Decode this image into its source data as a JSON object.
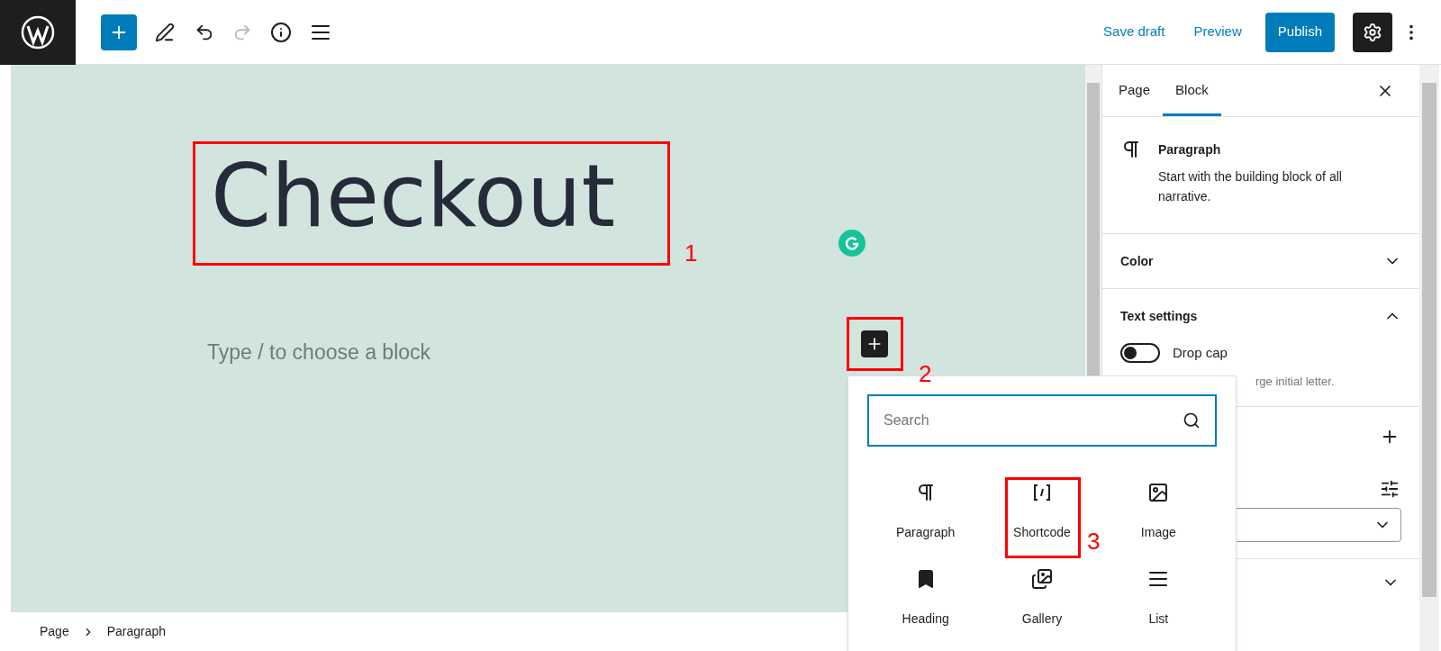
{
  "topbar": {
    "actions": [
      {
        "label": "Save draft",
        "kind": "link"
      },
      {
        "label": "Preview",
        "kind": "link"
      },
      {
        "label": "Publish",
        "kind": "primary"
      }
    ]
  },
  "editor": {
    "title": "Checkout",
    "placeholder": "Type / to choose a block"
  },
  "annotations": [
    {
      "label": "1"
    },
    {
      "label": "2"
    },
    {
      "label": "3"
    }
  ],
  "inserter": {
    "search_placeholder": "Search",
    "blocks": [
      {
        "label": "Paragraph",
        "kind": "paragraph"
      },
      {
        "label": "Shortcode",
        "kind": "shortcode"
      },
      {
        "label": "Image",
        "kind": "image"
      },
      {
        "label": "Heading",
        "kind": "heading"
      },
      {
        "label": "Gallery",
        "kind": "gallery"
      },
      {
        "label": "List",
        "kind": "list"
      }
    ]
  },
  "sidebar": {
    "tabs": [
      {
        "label": "Page",
        "selected": false
      },
      {
        "label": "Block",
        "selected": true
      }
    ],
    "block": {
      "name": "Paragraph",
      "description": "Start with the building block of all narrative."
    },
    "panels": [
      {
        "title": "Color",
        "expanded": false
      },
      {
        "title": "Text settings",
        "expanded": true
      }
    ],
    "drop_cap": {
      "label": "Drop cap",
      "on": false,
      "help": "rge initial letter."
    }
  },
  "breadcrumb": [
    "Page",
    "Paragraph"
  ]
}
